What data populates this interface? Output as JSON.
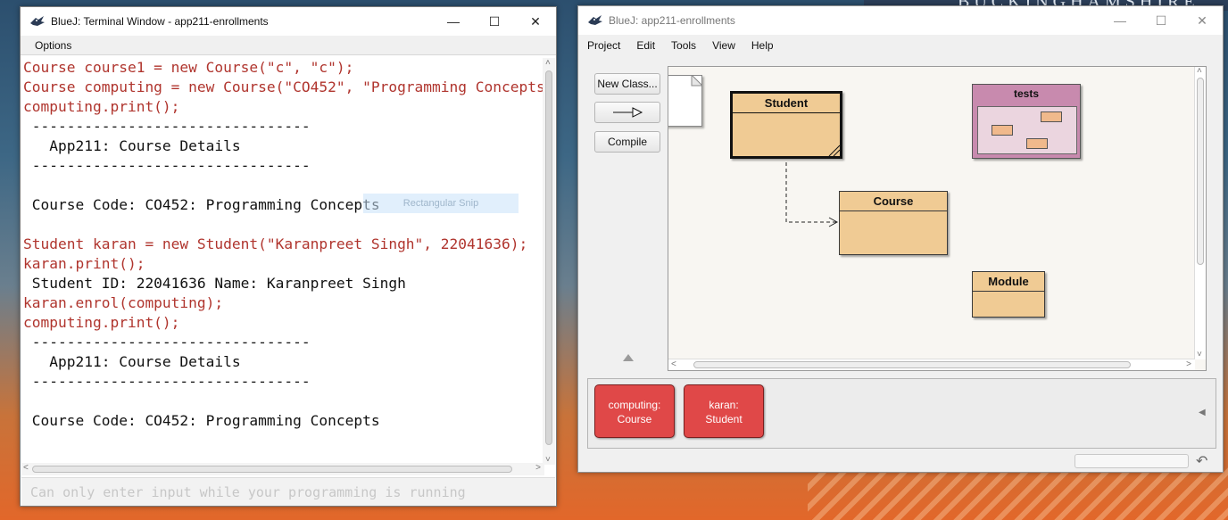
{
  "desktop": {
    "banner_text": "BUCKINGHAMSHIRE"
  },
  "terminal": {
    "title": "BlueJ: Terminal Window - app211-enrollments",
    "menu_options": "Options",
    "lines": [
      {
        "kind": "cmd",
        "text": "Course course1 = new Course(\"c\", \"c\");"
      },
      {
        "kind": "cmd",
        "text": "Course computing = new Course(\"CO452\", \"Programming Concepts\""
      },
      {
        "kind": "cmd",
        "text": "computing.print();"
      },
      {
        "kind": "out",
        "text": " --------------------------------"
      },
      {
        "kind": "out",
        "text": "   App211: Course Details"
      },
      {
        "kind": "out",
        "text": " --------------------------------"
      },
      {
        "kind": "out",
        "text": ""
      },
      {
        "kind": "out",
        "text": " Course Code: CO452: Programming Concepts"
      },
      {
        "kind": "out",
        "text": ""
      },
      {
        "kind": "cmd",
        "text": "Student karan = new Student(\"Karanpreet Singh\", 22041636);"
      },
      {
        "kind": "cmd",
        "text": "karan.print();"
      },
      {
        "kind": "out",
        "text": " Student ID: 22041636 Name: Karanpreet Singh"
      },
      {
        "kind": "cmd",
        "text": "karan.enrol(computing);"
      },
      {
        "kind": "cmd",
        "text": "computing.print();"
      },
      {
        "kind": "out",
        "text": " --------------------------------"
      },
      {
        "kind": "out",
        "text": "   App211: Course Details"
      },
      {
        "kind": "out",
        "text": " --------------------------------"
      },
      {
        "kind": "out",
        "text": ""
      },
      {
        "kind": "out",
        "text": " Course Code: CO452: Programming Concepts"
      }
    ],
    "input_placeholder": "Can only enter input while your programming is running",
    "snip_overlay": "Rectangular Snip"
  },
  "bluej": {
    "title": "BlueJ:  app211-enrollments",
    "menus": [
      "Project",
      "Edit",
      "Tools",
      "View",
      "Help"
    ],
    "toolbar": {
      "new_class": "New Class...",
      "compile": "Compile"
    },
    "classes": {
      "student": "Student",
      "course": "Course",
      "module": "Module"
    },
    "package_name": "tests",
    "objects": [
      {
        "name": "computing:",
        "type": "Course"
      },
      {
        "name": "karan:",
        "type": "Student"
      }
    ]
  },
  "colors": {
    "class_fill": "#f0cb94",
    "package_fill": "#c88aae",
    "object_fill": "#e04848",
    "command_text": "#b0352e"
  }
}
